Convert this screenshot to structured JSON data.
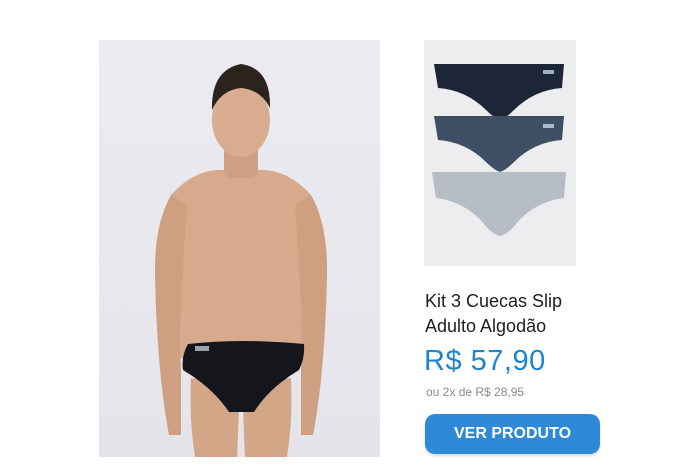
{
  "product": {
    "name_line1": "Kit 3 Cuecas Slip",
    "name_line2": "Adulto Algodão",
    "price": "R$ 57,90",
    "installment": "ou 2x de R$ 28,95",
    "cta_label": "VER PRODUTO"
  },
  "colors": {
    "price": "#1d84d0",
    "cta_background": "#2e8ad6",
    "slip_colors": [
      "#1c2636",
      "#3e4f63",
      "#b7bdc5"
    ]
  }
}
